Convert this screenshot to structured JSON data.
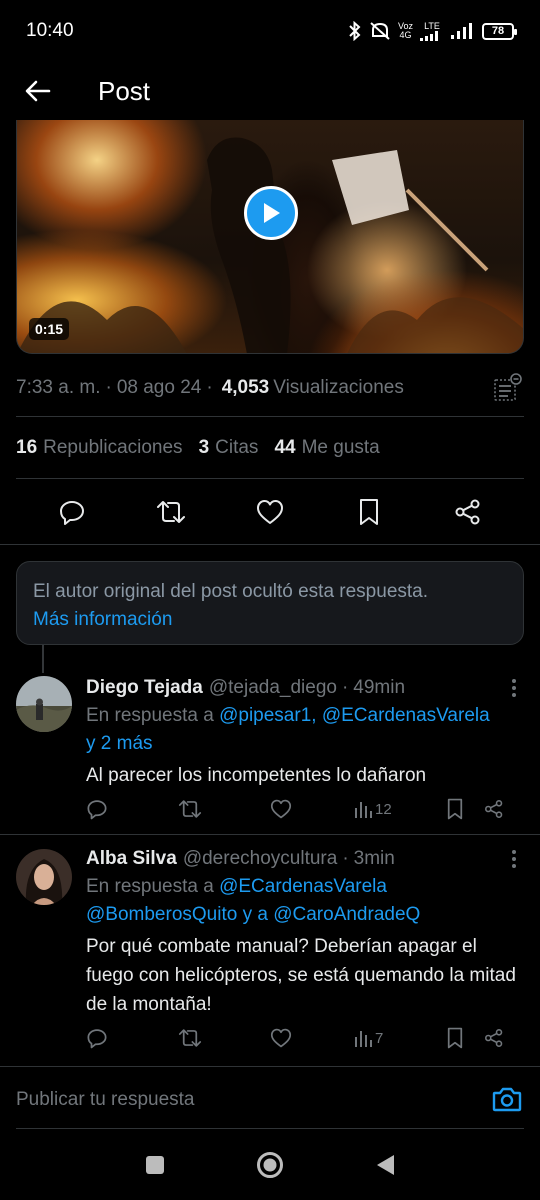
{
  "status_bar": {
    "time": "10:40",
    "network_label_top": "Voz",
    "network_label_bottom": "4G",
    "lte_label": "LTE",
    "battery": "78"
  },
  "header": {
    "title": "Post"
  },
  "post": {
    "media": {
      "duration": "0:15"
    },
    "meta": {
      "time": "7:33 a. m.",
      "separator": "·",
      "date": "08 ago 24",
      "views_count": "4,053",
      "views_label": "Visualizaciones"
    },
    "stats": {
      "reposts_count": "16",
      "reposts_label": "Republicaciones",
      "quotes_count": "3",
      "quotes_label": "Citas",
      "likes_count": "44",
      "likes_label": "Me gusta"
    }
  },
  "hidden_reply": {
    "text": "El autor original del post ocultó esta respuesta.",
    "link": "Más información"
  },
  "replies": [
    {
      "name": "Diego Tejada",
      "handle": "@tejada_diego",
      "ago": "49min",
      "replying_prefix": "En respuesta a",
      "replying_link_1": "@pipesar1, @ECardenasVarela",
      "replying_link_2": "y 2 más",
      "text": "Al parecer los incompetentes lo dañaron",
      "views": "12"
    },
    {
      "name": "Alba Silva",
      "handle": "@derechoycultura",
      "ago": "3min",
      "replying_prefix": "En respuesta a",
      "replying_link_1": "@ECardenasVarela",
      "replying_link_2": "@BomberosQuito",
      "replying_joiner": "y a",
      "replying_link_3": "@CaroAndradeQ",
      "text": "Por qué combate manual? Deberían apagar el fuego con helicópteros, se está quemando la mitad de la montaña!",
      "views": "7"
    }
  ],
  "composer": {
    "placeholder": "Publicar tu respuesta"
  },
  "colors": {
    "accent": "#1d9bf0",
    "background": "#000000",
    "secondary_text": "#71767b",
    "divider": "#2f3336"
  }
}
